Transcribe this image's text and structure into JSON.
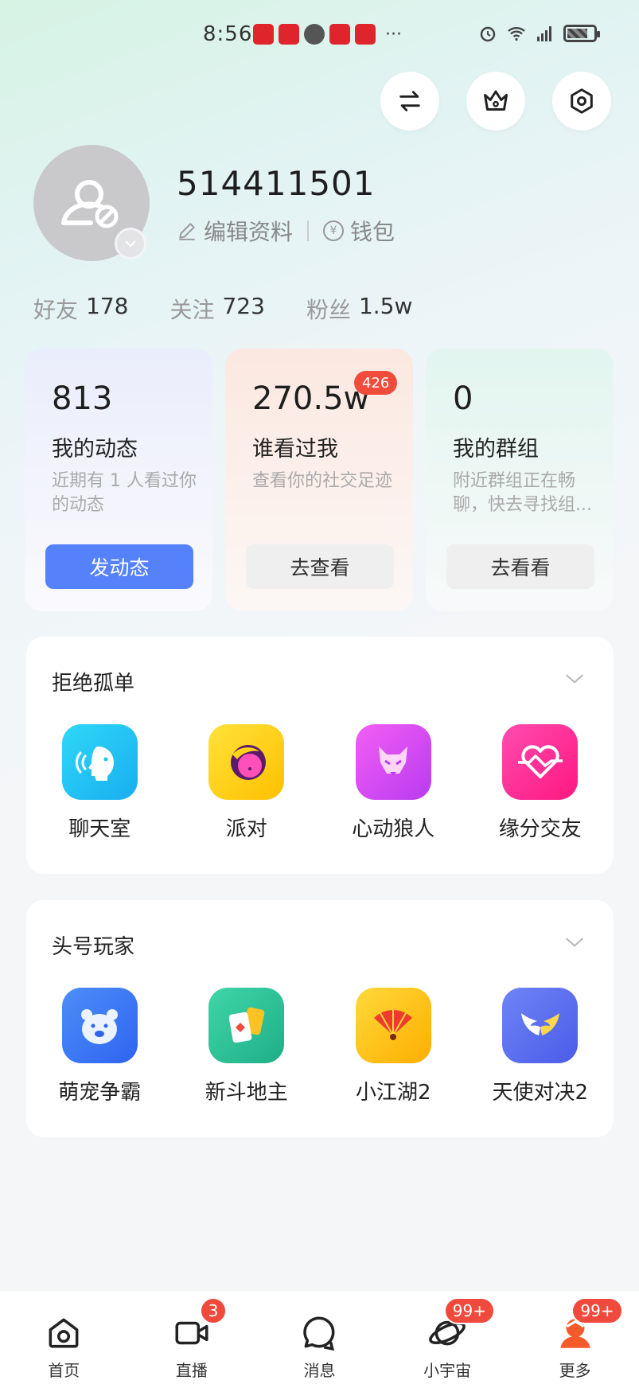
{
  "status_bar": {
    "time": "8:56",
    "more": "···",
    "signal": "5G"
  },
  "profile": {
    "username": "514411501",
    "edit_label": "编辑资料",
    "wallet_label": "钱包",
    "wallet_symbol": "¥",
    "stats": [
      {
        "label": "好友",
        "value": "178"
      },
      {
        "label": "关注",
        "value": "723"
      },
      {
        "label": "粉丝",
        "value": "1.5w"
      }
    ]
  },
  "cards": [
    {
      "number": "813",
      "title": "我的动态",
      "desc": "近期有 1 人看过你的动态",
      "button": "发动态",
      "badge": ""
    },
    {
      "number": "270.5w",
      "title": "谁看过我",
      "desc": "查看你的社交足迹",
      "button": "去查看",
      "badge": "426"
    },
    {
      "number": "0",
      "title": "我的群组",
      "desc": "附近群组正在畅聊，快去寻找组...",
      "button": "去看看",
      "badge": ""
    }
  ],
  "sections": [
    {
      "title": "拒绝孤单",
      "apps": [
        {
          "label": "聊天室",
          "icon": "chat-room-icon",
          "color": "#1cc4f2"
        },
        {
          "label": "派对",
          "icon": "party-icon",
          "color": "#ffd21a"
        },
        {
          "label": "心动狼人",
          "icon": "werewolf-icon",
          "color": "#e93cf0"
        },
        {
          "label": "缘分交友",
          "icon": "heart-match-icon",
          "color": "#ff2f9a"
        }
      ]
    },
    {
      "title": "头号玩家",
      "apps": [
        {
          "label": "萌宠争霸",
          "icon": "bear-icon",
          "color": "#3d7df6"
        },
        {
          "label": "新斗地主",
          "icon": "cards-icon",
          "color": "#2fc39a"
        },
        {
          "label": "小江湖2",
          "icon": "fan-icon",
          "color": "#ffc415"
        },
        {
          "label": "天使对决2",
          "icon": "wings-icon",
          "color": "#5b70f2"
        }
      ]
    }
  ],
  "bottom_nav": [
    {
      "label": "首页",
      "badge": ""
    },
    {
      "label": "直播",
      "badge": "3"
    },
    {
      "label": "消息",
      "badge": ""
    },
    {
      "label": "小宇宙",
      "badge": "99+"
    },
    {
      "label": "更多",
      "badge": "99+"
    }
  ],
  "colors": {
    "primary": "#5582fb",
    "badge_red": "#ef4c3c",
    "more_accent": "#f55a2a"
  }
}
